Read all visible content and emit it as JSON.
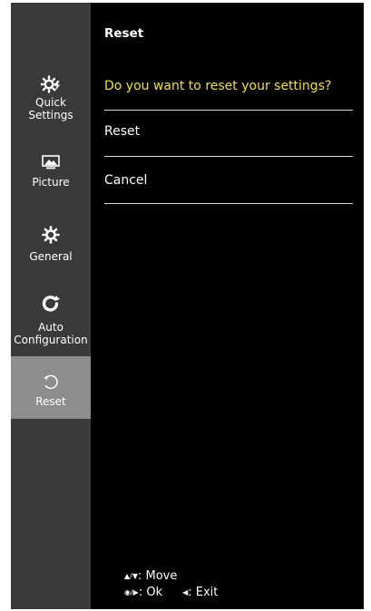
{
  "sidebar": {
    "items": [
      {
        "label_line1": "Quick",
        "label_line2": "Settings",
        "icon": "quick-settings-icon"
      },
      {
        "label": "Picture",
        "icon": "picture-icon"
      },
      {
        "label": "General",
        "icon": "gear-icon"
      },
      {
        "label_line1": "Auto",
        "label_line2": "Configuration",
        "icon": "auto-configuration-icon"
      },
      {
        "label": "Reset",
        "icon": "reset-icon",
        "active": true
      }
    ]
  },
  "main": {
    "title": "Reset",
    "question": "Do you want to reset your settings?",
    "options": [
      "Reset",
      "Cancel"
    ]
  },
  "hints": {
    "move_keys": "▲/▼",
    "move_label": ": Move",
    "ok_keys": "◉/▶",
    "ok_label": ": Ok",
    "exit_key": "◀",
    "exit_label": ": Exit"
  },
  "colors": {
    "sidebar": "#3a3a3a",
    "active": "#8d8d8d",
    "question": "#f5e600"
  }
}
